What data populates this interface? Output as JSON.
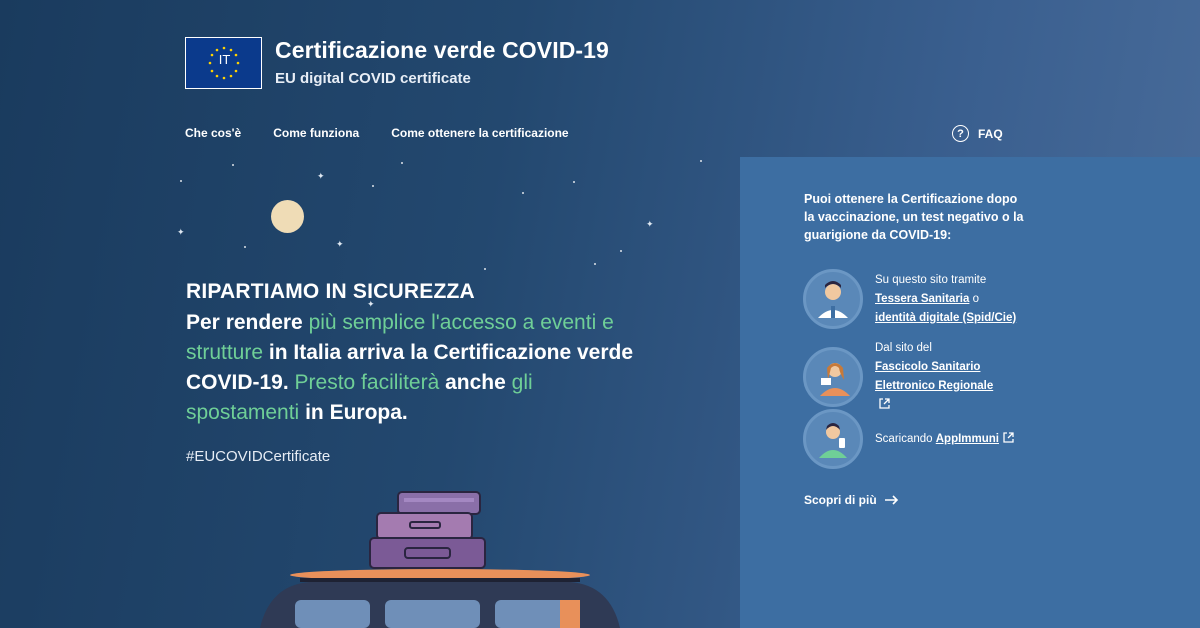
{
  "brand": {
    "logo_code": "IT",
    "title": "Certificazione verde COVID-19",
    "subtitle": "EU digital COVID certificate"
  },
  "nav": {
    "items": [
      "Che cos'è",
      "Come funziona",
      "Come ottenere la certificazione"
    ],
    "faq_label": "FAQ"
  },
  "hero": {
    "headline": "RIPARTIAMO IN SICUREZZA",
    "lead_parts": [
      {
        "text": "Per rendere ",
        "green": false
      },
      {
        "text": "più semplice l'accesso a eventi e strutture",
        "green": true
      },
      {
        "text": " in Italia arriva la Certificazione verde COVID-19. ",
        "green": false
      },
      {
        "text": "Presto faciliterà",
        "green": true
      },
      {
        "text": " anche ",
        "green": false
      },
      {
        "text": "gli spostamenti",
        "green": true
      },
      {
        "text": " in Europa.",
        "green": false
      }
    ],
    "hashtag": "#EUCOVIDCertificate"
  },
  "panel": {
    "intro": "Puoi ottenere la Certificazione dopo la vaccinazione, un test negativo o la guarigione da COVID-19:",
    "option1": {
      "prefix": "Su questo sito tramite",
      "link1": "Tessera Sanitaria",
      "mid": " o",
      "link2": "identità digitale (Spid/Cie)"
    },
    "option2": {
      "prefix": "Dal sito del",
      "link": "Fascicolo Sanitario Elettronico Regionale"
    },
    "option3": {
      "prefix": "Scaricando ",
      "link": "AppImmuni"
    },
    "more_label": "Scopri di più"
  },
  "colors": {
    "accent_green": "#6fcf97",
    "panel": "#3d6ea2",
    "moon": "#efdcb6"
  }
}
